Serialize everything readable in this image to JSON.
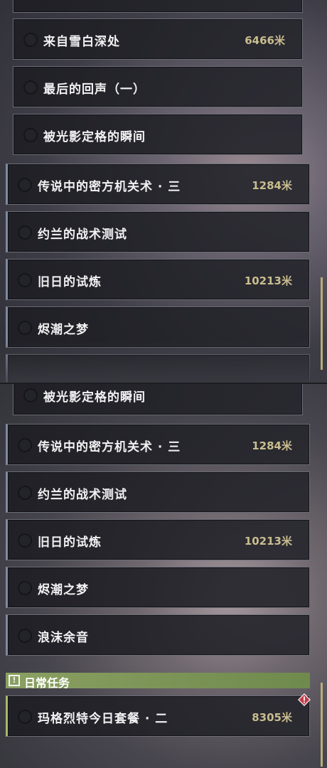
{
  "top_list": [
    {
      "name": "来自雪白深处",
      "distance": "6466米"
    },
    {
      "name": "最后的回声（一）",
      "distance": ""
    },
    {
      "name": "被光影定格的瞬间",
      "distance": ""
    },
    {
      "name": "传说中的密方机关术 · 三",
      "distance": "1284米"
    },
    {
      "name": "约兰的战术测试",
      "distance": ""
    },
    {
      "name": "旧日的试炼",
      "distance": "10213米"
    },
    {
      "name": "烬潮之梦",
      "distance": ""
    }
  ],
  "bottom_list": [
    {
      "name": "被光影定格的瞬间",
      "distance": ""
    },
    {
      "name": "传说中的密方机关术 · 三",
      "distance": "1284米"
    },
    {
      "name": "约兰的战术测试",
      "distance": ""
    },
    {
      "name": "旧日的试炼",
      "distance": "10213米"
    },
    {
      "name": "烬潮之梦",
      "distance": ""
    },
    {
      "name": "浪沫余音",
      "distance": ""
    }
  ],
  "daily_section": {
    "title": "日常任务",
    "icon": "exclamation-icon",
    "quest": {
      "name": "玛格烈特今日套餐 · 二",
      "distance": "8305米"
    }
  },
  "colors": {
    "accent_daily": "#8aa062",
    "distance_text": "#c9bd8f",
    "scrollbar": "#b8ae78"
  }
}
